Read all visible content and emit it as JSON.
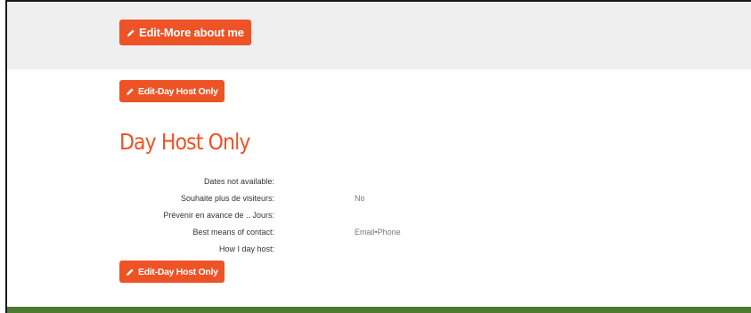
{
  "header": {
    "edit_more_label": "Edit-More about me"
  },
  "section": {
    "edit_label_top": "Edit-Day Host Only",
    "title": "Day Host Only",
    "edit_label_bottom": "Edit-Day Host Only",
    "fields": [
      {
        "label": "Dates not available:",
        "value": ""
      },
      {
        "label": "Souhaite plus de visiteurs:",
        "value": "No"
      },
      {
        "label": "Prévenir en avance de .. Jours:",
        "value": ""
      },
      {
        "label": "Best means of contact:",
        "value": "Email•Phone"
      },
      {
        "label": "How I day host:",
        "value": ""
      }
    ]
  },
  "colors": {
    "accent": "#ee5326",
    "top_band": "#efefef",
    "footer": "#4e7a31"
  },
  "icons": {
    "edit": "pencil-icon"
  }
}
